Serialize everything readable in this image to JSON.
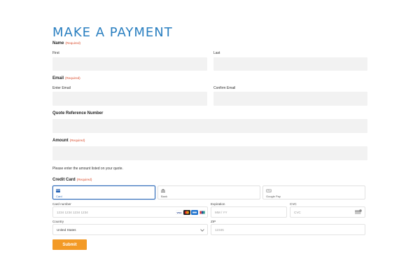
{
  "page": {
    "title": "MAKE A PAYMENT"
  },
  "name": {
    "label": "Name",
    "required": "(Required)",
    "first_label": "First",
    "last_label": "Last"
  },
  "email": {
    "label": "Email",
    "required": "(Required)",
    "enter_label": "Enter Email",
    "confirm_label": "Confirm Email"
  },
  "quote": {
    "label": "Quote Reference Number"
  },
  "amount": {
    "label": "Amount",
    "required": "(Required)",
    "help": "Please enter the amount listed on your quote."
  },
  "credit_card": {
    "label": "Credit Card",
    "required": "(Required)",
    "tabs": [
      {
        "label": "Card",
        "icon": "card-icon",
        "active": true
      },
      {
        "label": "Bank",
        "icon": "bank-icon",
        "active": false
      },
      {
        "label": "Google Pay",
        "icon": "google-pay-icon",
        "active": false
      }
    ],
    "card_number_label": "Card number",
    "card_number_placeholder": "1234 1234 1234 1234",
    "expiration_label": "Expiration",
    "expiration_placeholder": "MM / YY",
    "cvc_label": "CVC",
    "cvc_placeholder": "CVC",
    "country_label": "Country",
    "country_value": "United States",
    "zip_label": "ZIP",
    "zip_placeholder": "12345",
    "brands": [
      "visa",
      "mastercard",
      "amex",
      "unionpay"
    ]
  },
  "submit": {
    "label": "Submit"
  },
  "colors": {
    "title": "#2a7fc0",
    "required": "#d94b2b",
    "field_bg": "#f2f2f2",
    "active_tab": "#2b68b8",
    "submit_bg": "#f39a26"
  }
}
